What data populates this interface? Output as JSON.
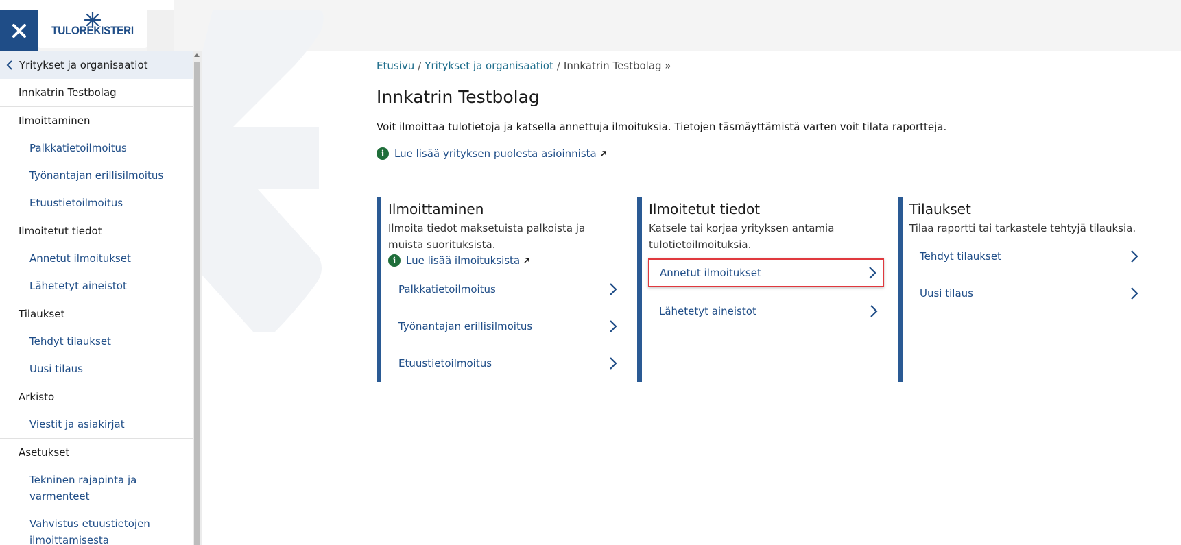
{
  "header": {
    "logo_text": "TULOREKISTERI",
    "close_icon": "close-icon"
  },
  "sidebar": {
    "back_label": "Yritykset ja organisaatiot",
    "sections": [
      {
        "title": "Innkatrin Testbolag",
        "items": []
      },
      {
        "title": "Ilmoittaminen",
        "items": [
          "Palkkatietoilmoitus",
          "Työnantajan erillisilmoitus",
          "Etuustietoilmoitus"
        ]
      },
      {
        "title": "Ilmoitetut tiedot",
        "items": [
          "Annetut ilmoitukset",
          "Lähetetyt aineistot"
        ]
      },
      {
        "title": "Tilaukset",
        "items": [
          "Tehdyt tilaukset",
          "Uusi tilaus"
        ]
      },
      {
        "title": "Arkisto",
        "items": [
          "Viestit ja asiakirjat"
        ]
      },
      {
        "title": "Asetukset",
        "items": [
          "Tekninen rajapinta ja varmenteet",
          "Vahvistus etuustietojen ilmoittamisesta"
        ]
      }
    ]
  },
  "breadcrumb": {
    "home": "Etusivu",
    "parent": "Yritykset ja organisaatiot",
    "current": "Innkatrin Testbolag »",
    "separator": "/"
  },
  "page": {
    "title": "Innkatrin Testbolag",
    "intro": "Voit ilmoittaa tulotietoja ja katsella annettuja ilmoituksia. Tietojen täsmäyttämistä varten voit tilata raportteja.",
    "info_link": "Lue lisää yrityksen puolesta asioinnista"
  },
  "cards": [
    {
      "title": "Ilmoittaminen",
      "desc": "Ilmoita tiedot maksetuista palkoista ja muista suorituksista.",
      "info_link": "Lue lisää ilmoituksista",
      "links": [
        "Palkkatietoilmoitus",
        "Työnantajan erillisilmoitus",
        "Etuustietoilmoitus"
      ]
    },
    {
      "title": "Ilmoitetut tiedot",
      "desc": "Katsele tai korjaa yrityksen antamia tulotietoilmoituksia.",
      "info_link": "",
      "links": [
        "Annetut ilmoitukset",
        "Lähetetyt aineistot"
      ]
    },
    {
      "title": "Tilaukset",
      "desc": "Tilaa raportti tai tarkastele tehtyjä tilauksia.",
      "info_link": "",
      "links": [
        "Tehdyt tilaukset",
        "Uusi tilaus"
      ]
    }
  ],
  "colors": {
    "brand_blue": "#1f4d87",
    "link_teal": "#1f6e8c",
    "info_green": "#1f6e3a",
    "highlight_red": "#e0393e"
  }
}
